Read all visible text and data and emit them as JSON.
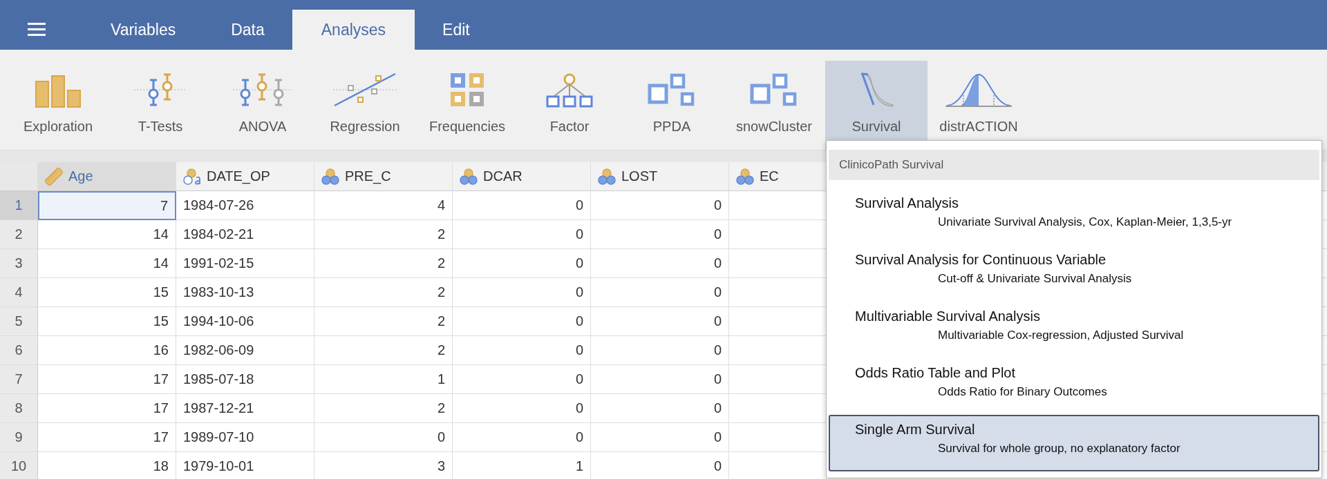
{
  "tabs": [
    {
      "label": "Variables",
      "selected": false
    },
    {
      "label": "Data",
      "selected": false
    },
    {
      "label": "Analyses",
      "selected": true
    },
    {
      "label": "Edit",
      "selected": false
    }
  ],
  "toolbar": [
    {
      "label": "Exploration",
      "kind": "exploration",
      "selected": false
    },
    {
      "label": "T-Tests",
      "kind": "ttests",
      "selected": false
    },
    {
      "label": "ANOVA",
      "kind": "anova",
      "selected": false
    },
    {
      "label": "Regression",
      "kind": "regression",
      "selected": false
    },
    {
      "label": "Frequencies",
      "kind": "frequencies",
      "selected": false
    },
    {
      "label": "Factor",
      "kind": "factor",
      "selected": false
    },
    {
      "label": "PPDA",
      "kind": "ppda",
      "selected": false
    },
    {
      "label": "snowCluster",
      "kind": "snowcluster",
      "selected": false
    },
    {
      "label": "Survival",
      "kind": "survival",
      "selected": true
    },
    {
      "label": "distrACTION",
      "kind": "distraction",
      "selected": false
    }
  ],
  "table": {
    "columns": [
      {
        "name": "Age",
        "kind": "continuous",
        "selected": true
      },
      {
        "name": "DATE_OP",
        "kind": "nominal-text",
        "selected": false
      },
      {
        "name": "PRE_C",
        "kind": "nominal",
        "selected": false
      },
      {
        "name": "DCAR",
        "kind": "nominal",
        "selected": false
      },
      {
        "name": "LOST",
        "kind": "nominal",
        "selected": false
      },
      {
        "name": "EC",
        "kind": "nominal",
        "selected": false
      }
    ],
    "rows": [
      {
        "number": "1",
        "selected": true,
        "cells": [
          "7",
          "1984-07-26",
          "4",
          "0",
          "0"
        ]
      },
      {
        "number": "2",
        "selected": false,
        "cells": [
          "14",
          "1984-02-21",
          "2",
          "0",
          "0"
        ]
      },
      {
        "number": "3",
        "selected": false,
        "cells": [
          "14",
          "1991-02-15",
          "2",
          "0",
          "0"
        ]
      },
      {
        "number": "4",
        "selected": false,
        "cells": [
          "15",
          "1983-10-13",
          "2",
          "0",
          "0"
        ]
      },
      {
        "number": "5",
        "selected": false,
        "cells": [
          "15",
          "1994-10-06",
          "2",
          "0",
          "0"
        ]
      },
      {
        "number": "6",
        "selected": false,
        "cells": [
          "16",
          "1982-06-09",
          "2",
          "0",
          "0"
        ]
      },
      {
        "number": "7",
        "selected": false,
        "cells": [
          "17",
          "1985-07-18",
          "1",
          "0",
          "0"
        ]
      },
      {
        "number": "8",
        "selected": false,
        "cells": [
          "17",
          "1987-12-21",
          "2",
          "0",
          "0"
        ]
      },
      {
        "number": "9",
        "selected": false,
        "cells": [
          "17",
          "1989-07-10",
          "0",
          "0",
          "0"
        ]
      },
      {
        "number": "10",
        "selected": false,
        "cells": [
          "18",
          "1979-10-01",
          "3",
          "1",
          "0"
        ]
      }
    ]
  },
  "menu": {
    "header": "ClinicoPath Survival",
    "items": [
      {
        "title": "Survival Analysis",
        "subtitle": "Univariate Survival Analysis, Cox, Kaplan-Meier, 1,3,5-yr",
        "selected": false
      },
      {
        "title": "Survival Analysis for Continuous Variable",
        "subtitle": "Cut-off & Univariate Survival Analysis",
        "selected": false
      },
      {
        "title": "Multivariable Survival Analysis",
        "subtitle": "Multivariable Cox-regression, Adjusted Survival",
        "selected": false
      },
      {
        "title": "Odds Ratio Table and Plot",
        "subtitle": "Odds Ratio for Binary Outcomes",
        "selected": false
      },
      {
        "title": "Single Arm Survival",
        "subtitle": "Survival for whole group, no explanatory factor",
        "selected": true
      }
    ]
  }
}
